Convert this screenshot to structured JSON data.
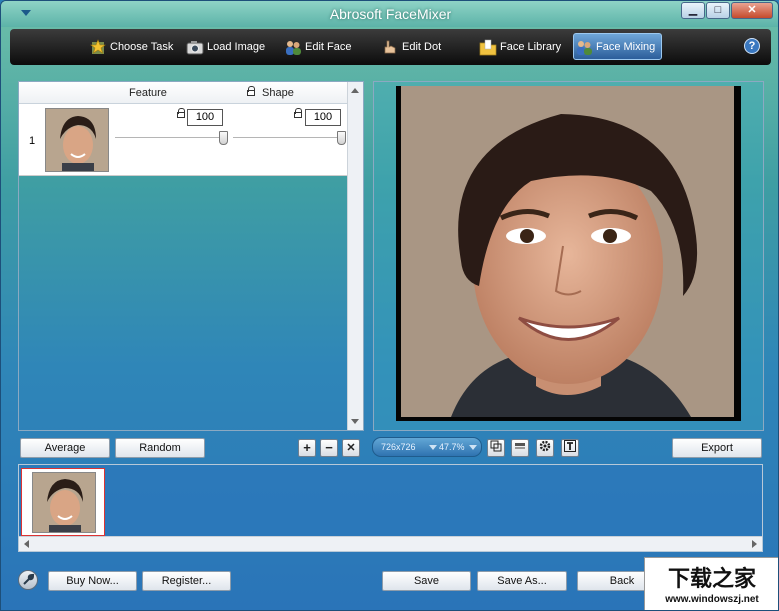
{
  "window": {
    "title": "Abrosoft FaceMixer",
    "minimize_glyph": "▁",
    "maximize_glyph": "□",
    "close_glyph": "✕"
  },
  "toolbar": {
    "tabs": [
      {
        "label": "Choose Task",
        "icon": "star-icon",
        "active": false
      },
      {
        "label": "Load Image",
        "icon": "camera-icon",
        "active": false
      },
      {
        "label": "Edit Face",
        "icon": "people-icon",
        "active": false
      },
      {
        "label": "Edit Dot",
        "icon": "hand-icon",
        "active": false
      },
      {
        "label": "Face Library",
        "icon": "folder-icon",
        "active": false
      },
      {
        "label": "Face Mixing",
        "icon": "people-icon",
        "active": true
      }
    ],
    "help_glyph": "?"
  },
  "mixing": {
    "header_feature": "Feature",
    "header_shape": "Shape",
    "rows": [
      {
        "index": "1",
        "feature_value": "100",
        "shape_value": "100",
        "feature_fraction": 1.0,
        "shape_fraction": 1.0
      }
    ]
  },
  "buttons": {
    "average": "Average",
    "random": "Random",
    "add_glyph": "+",
    "remove_glyph": "−",
    "clear_glyph": "✕",
    "export": "Export",
    "buy_now": "Buy Now...",
    "register": "Register...",
    "save": "Save",
    "save_as": "Save As...",
    "back": "Back"
  },
  "zoom": {
    "size": "726x726",
    "percent": "47.7%"
  },
  "view_tools": [
    "fit-icon",
    "flip-icon",
    "settings-icon",
    "text-icon"
  ],
  "watermark": {
    "line1": "下载之家",
    "line2": "www.windowszj.net"
  },
  "colors": {
    "active_tab": "#3d78bb",
    "window_gradient_top": "#6fc0a9",
    "window_gradient_bottom": "#2a74b8"
  }
}
